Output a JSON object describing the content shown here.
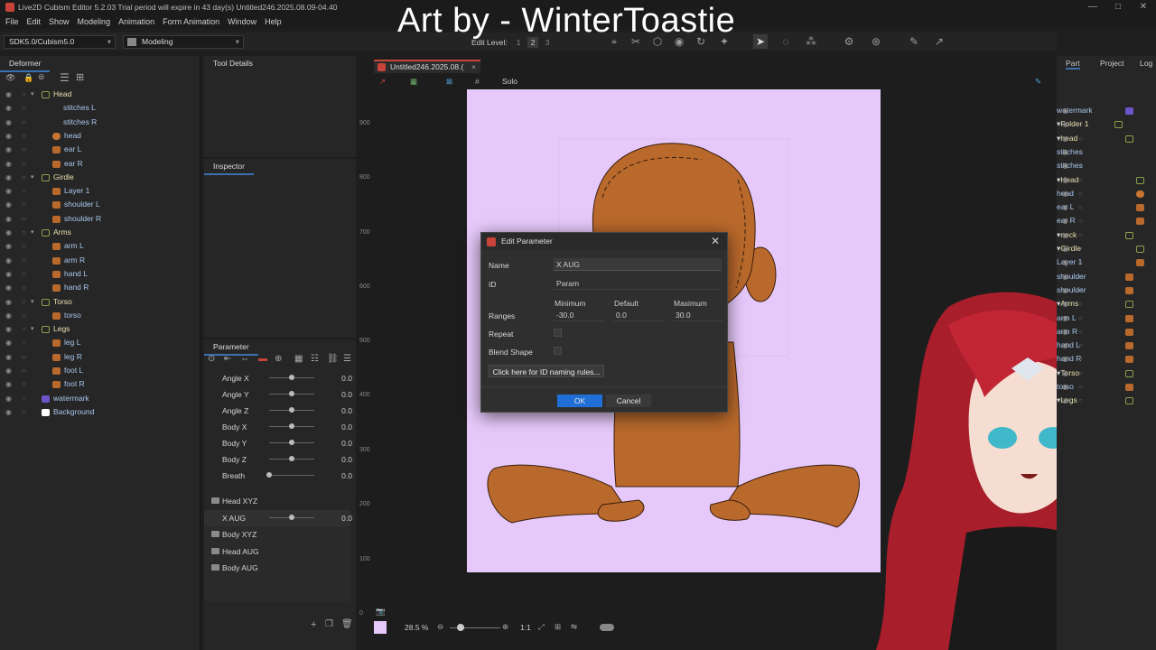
{
  "window": {
    "title": "Live2D Cubism Editor 5.2.03   Trial period will expire in 43 day(s)   Untitled246.2025.08.09-04.40",
    "controls": [
      "—",
      "□",
      "✕"
    ]
  },
  "menu": [
    "File",
    "Edit",
    "Show",
    "Modeling",
    "Animation",
    "Form Animation",
    "Window",
    "Help"
  ],
  "credit": "Art by - WinterToastie",
  "toolbar": {
    "sdk_combo": "SDK5.0/Cubism5.0",
    "mode_combo": "Modeling",
    "edit_level_label": "Edit Level:",
    "edit_levels": [
      "1",
      "2",
      "3"
    ]
  },
  "deformer_panel": {
    "title": "Deformer",
    "rows": [
      {
        "label": "Head",
        "kind": "folder",
        "indent": 0
      },
      {
        "label": "stitches L",
        "kind": "child",
        "indent": 2
      },
      {
        "label": "stitches R",
        "kind": "child",
        "indent": 2
      },
      {
        "label": "head",
        "kind": "part-head",
        "indent": 1
      },
      {
        "label": "ear L",
        "kind": "part",
        "indent": 1
      },
      {
        "label": "ear R",
        "kind": "part",
        "indent": 1
      },
      {
        "label": "Girdle",
        "kind": "folder",
        "indent": 0
      },
      {
        "label": "Layer 1",
        "kind": "part",
        "indent": 1
      },
      {
        "label": "shoulder L",
        "kind": "part",
        "indent": 1
      },
      {
        "label": "shoulder R",
        "kind": "part",
        "indent": 1
      },
      {
        "label": "Arms",
        "kind": "folder",
        "indent": 0
      },
      {
        "label": "arm L",
        "kind": "part",
        "indent": 1
      },
      {
        "label": "arm R",
        "kind": "part",
        "indent": 1
      },
      {
        "label": "hand L",
        "kind": "part",
        "indent": 1
      },
      {
        "label": "hand R",
        "kind": "part",
        "indent": 1
      },
      {
        "label": "Torso",
        "kind": "folder",
        "indent": 0
      },
      {
        "label": "torso",
        "kind": "part",
        "indent": 1
      },
      {
        "label": "Legs",
        "kind": "folder",
        "indent": 0
      },
      {
        "label": "leg L",
        "kind": "part",
        "indent": 1
      },
      {
        "label": "leg R",
        "kind": "part",
        "indent": 1
      },
      {
        "label": "foot L",
        "kind": "part",
        "indent": 1
      },
      {
        "label": "foot R",
        "kind": "part",
        "indent": 1
      },
      {
        "label": "watermark",
        "kind": "wm",
        "indent": 0
      },
      {
        "label": "Background",
        "kind": "bg",
        "indent": 0
      }
    ]
  },
  "tool_details": {
    "title": "Tool Details"
  },
  "inspector": {
    "title": "Inspector"
  },
  "parameter_panel": {
    "title": "Parameter",
    "params": [
      {
        "name": "Angle X",
        "value": "0.0",
        "pos": 0.5
      },
      {
        "name": "Angle Y",
        "value": "0.0",
        "pos": 0.5
      },
      {
        "name": "Angle Z",
        "value": "0.0",
        "pos": 0.5
      },
      {
        "name": "Body X",
        "value": "0.0",
        "pos": 0.5
      },
      {
        "name": "Body Y",
        "value": "0.0",
        "pos": 0.5
      },
      {
        "name": "Body Z",
        "value": "0.0",
        "pos": 0.5
      },
      {
        "name": "Breath",
        "value": "0.0",
        "pos": 0.0
      }
    ],
    "groups": [
      {
        "name": "Head XYZ",
        "type": "group"
      },
      {
        "name": "X AUG",
        "type": "param",
        "value": "0.0",
        "pos": 0.5
      },
      {
        "name": "Body XYZ",
        "type": "group"
      },
      {
        "name": "Head AUG",
        "type": "group"
      },
      {
        "name": "Body AUG",
        "type": "group"
      }
    ]
  },
  "document": {
    "tab_label": "Untitled246.2025.08.(",
    "solo_label": "Solo",
    "ruler_ticks": [
      "900",
      "800",
      "700",
      "600",
      "500",
      "400",
      "300",
      "200",
      "100",
      "0"
    ],
    "zoom": "28.5 %",
    "scale_label": "1:1"
  },
  "dialog": {
    "title": "Edit Parameter",
    "name_label": "Name",
    "name_value": "X AUG",
    "id_label": "ID",
    "id_value": "Param",
    "minimum_label": "Minimum",
    "default_label": "Default",
    "maximum_label": "Maximum",
    "ranges_label": "Ranges",
    "min_value": "-30.0",
    "default_value": "0.0",
    "max_value": "30.0",
    "repeat_label": "Repeat",
    "blend_label": "Blend Shape",
    "rules_button": "Click here for ID naming rules...",
    "ok": "OK",
    "cancel": "Cancel"
  },
  "right_panel": {
    "tabs": [
      "Part",
      "Project",
      "Log"
    ],
    "rows": [
      {
        "label": "watermark",
        "kind": "wm",
        "indent": 2
      },
      {
        "label": "Folder 1",
        "kind": "folder",
        "indent": 1
      },
      {
        "label": "head",
        "kind": "folder",
        "indent": 2
      },
      {
        "label": "stitches",
        "kind": "child",
        "indent": 3
      },
      {
        "label": "stitches",
        "kind": "child",
        "indent": 3
      },
      {
        "label": "Head",
        "kind": "folder",
        "indent": 3
      },
      {
        "label": "head",
        "kind": "part-head",
        "indent": 3
      },
      {
        "label": "ear L",
        "kind": "part",
        "indent": 3
      },
      {
        "label": "ear R",
        "kind": "part",
        "indent": 3
      },
      {
        "label": "neck",
        "kind": "folder",
        "indent": 2
      },
      {
        "label": "Girdle",
        "kind": "folder",
        "indent": 3
      },
      {
        "label": "Layer 1",
        "kind": "part",
        "indent": 3
      },
      {
        "label": "shoulder",
        "kind": "part",
        "indent": 2
      },
      {
        "label": "shoulder",
        "kind": "part",
        "indent": 2
      },
      {
        "label": "Arms",
        "kind": "folder",
        "indent": 2
      },
      {
        "label": "arm L",
        "kind": "part",
        "indent": 2
      },
      {
        "label": "arm R",
        "kind": "part",
        "indent": 2
      },
      {
        "label": "hand L",
        "kind": "part",
        "indent": 2
      },
      {
        "label": "hand R",
        "kind": "part",
        "indent": 2
      },
      {
        "label": "Torso",
        "kind": "folder",
        "indent": 2
      },
      {
        "label": "torso",
        "kind": "part",
        "indent": 2
      },
      {
        "label": "Legs",
        "kind": "folder",
        "indent": 2
      }
    ]
  },
  "colors": {
    "accent_blue": "#1f6fd6",
    "canvas_bg": "#e6c9fa",
    "skin": "#b9692c",
    "hair_red": "#a81e2a"
  }
}
